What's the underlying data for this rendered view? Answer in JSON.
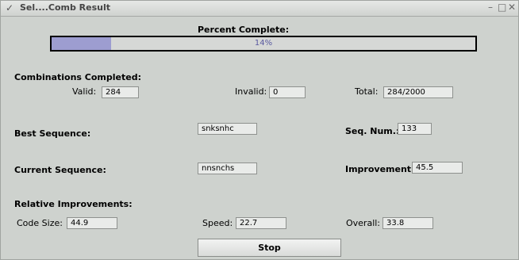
{
  "window": {
    "title": "Sel....Comb Result",
    "menu_glyph": "✓",
    "minimize_glyph": "–",
    "maximize_glyph": "□",
    "close_glyph": "✕"
  },
  "progress": {
    "label": "Percent Complete:",
    "value_text": "14%",
    "fraction": 0.14,
    "fill_color": "#9d9dd0"
  },
  "combinations": {
    "heading": "Combinations Completed:",
    "valid_label": "Valid:",
    "valid_value": "284",
    "invalid_label": "Invalid:",
    "invalid_value": "0",
    "total_label": "Total:",
    "total_value": "284/2000"
  },
  "best": {
    "label": "Best Sequence:",
    "value": "snksnhc",
    "seq_num_label": "Seq. Num.:",
    "seq_num_value": "133"
  },
  "current": {
    "label": "Current Sequence:",
    "value": "nnsnchs",
    "improvement_label": "Improvement:",
    "improvement_value": "45.5"
  },
  "relative": {
    "heading": "Relative Improvements:",
    "code_size_label": "Code Size:",
    "code_size_value": "44.9",
    "speed_label": "Speed:",
    "speed_value": "22.7",
    "overall_label": "Overall:",
    "overall_value": "33.8"
  },
  "actions": {
    "stop_label": "Stop"
  }
}
